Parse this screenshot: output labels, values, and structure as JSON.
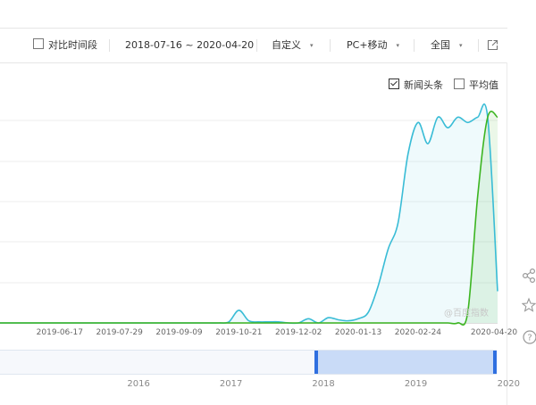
{
  "toolbar": {
    "compare_period_label": "对比时间段",
    "date_range": "2018-07-16 ~ 2020-04-20",
    "custom_label": "自定义",
    "device_label": "PC+移动",
    "region_label": "全国",
    "dropdown_caret": "▾"
  },
  "legend": {
    "items": [
      {
        "label": "新闻头条",
        "checked": true,
        "color": "#39bcd6"
      },
      {
        "label": "平均值",
        "checked": false,
        "color": "#3cb521"
      }
    ]
  },
  "watermark": "@百度指数",
  "chart_data": {
    "type": "line",
    "x": [
      "2019-05-06",
      "2019-05-13",
      "2019-05-20",
      "2019-05-27",
      "2019-06-03",
      "2019-06-10",
      "2019-06-17",
      "2019-06-24",
      "2019-07-01",
      "2019-07-08",
      "2019-07-15",
      "2019-07-22",
      "2019-07-29",
      "2019-08-05",
      "2019-08-12",
      "2019-08-19",
      "2019-08-26",
      "2019-09-02",
      "2019-09-09",
      "2019-09-16",
      "2019-09-23",
      "2019-09-30",
      "2019-10-07",
      "2019-10-14",
      "2019-10-21",
      "2019-10-28",
      "2019-11-04",
      "2019-11-11",
      "2019-11-18",
      "2019-11-25",
      "2019-12-02",
      "2019-12-09",
      "2019-12-16",
      "2019-12-23",
      "2019-12-30",
      "2020-01-06",
      "2020-01-13",
      "2020-01-20",
      "2020-01-27",
      "2020-02-03",
      "2020-02-10",
      "2020-02-17",
      "2020-02-24",
      "2020-03-02",
      "2020-03-09",
      "2020-03-16",
      "2020-03-23",
      "2020-03-30",
      "2020-04-06",
      "2020-04-13",
      "2020-04-20"
    ],
    "series": [
      {
        "name": "新闻头条",
        "color": "#39bcd6",
        "values": [
          0,
          0,
          0,
          0,
          0,
          0,
          0,
          0,
          0,
          0,
          0,
          0,
          0,
          0,
          0,
          0,
          0,
          0,
          0,
          0,
          0,
          0,
          0,
          1,
          12,
          2,
          1,
          1,
          1,
          0,
          0,
          4,
          0,
          5,
          3,
          2,
          4,
          10,
          35,
          70,
          95,
          160,
          190,
          170,
          195,
          185,
          195,
          190,
          195,
          195,
          30
        ]
      },
      {
        "name": "平均值",
        "color": "#3cb521",
        "values": [
          0,
          0,
          0,
          0,
          0,
          0,
          0,
          0,
          0,
          0,
          0,
          0,
          0,
          0,
          0,
          0,
          0,
          0,
          0,
          0,
          0,
          0,
          0,
          0,
          0,
          0,
          0,
          0,
          0,
          0,
          0,
          0,
          0,
          0,
          0,
          0,
          0,
          0,
          0,
          0,
          0,
          0,
          0,
          0,
          0,
          0,
          0,
          10,
          120,
          195,
          195
        ]
      }
    ],
    "x_tick_labels": [
      "2019-06-17",
      "2019-07-29",
      "2019-09-09",
      "2019-10-21",
      "2019-12-02",
      "2020-01-13",
      "2020-02-24",
      "2020-04-20"
    ],
    "ylim": [
      0,
      230
    ],
    "grid": true,
    "legend_position": "top-right"
  },
  "navigator": {
    "years": [
      "2016",
      "2017",
      "2018",
      "2019",
      "2020"
    ],
    "selected_range": [
      "2018-07-16",
      "2020-04-20"
    ]
  },
  "side_icons": [
    "share-icon",
    "star-icon",
    "help-icon"
  ]
}
